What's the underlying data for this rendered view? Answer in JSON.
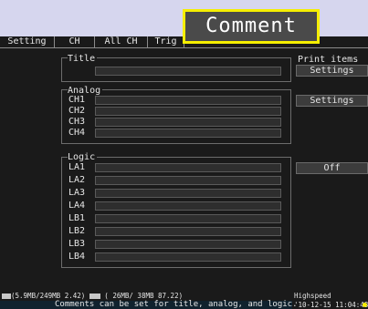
{
  "callout": {
    "label": "Comment"
  },
  "tabs": [
    "Setting",
    "CH",
    "All CH",
    "Trig"
  ],
  "title_section": {
    "label": "Title",
    "value": ""
  },
  "analog_section": {
    "label": "Analog",
    "channels": [
      {
        "name": "CH1",
        "value": ""
      },
      {
        "name": "CH2",
        "value": ""
      },
      {
        "name": "CH3",
        "value": ""
      },
      {
        "name": "CH4",
        "value": ""
      }
    ]
  },
  "logic_section": {
    "label": "Logic",
    "channels": [
      {
        "name": "LA1",
        "value": ""
      },
      {
        "name": "LA2",
        "value": ""
      },
      {
        "name": "LA3",
        "value": ""
      },
      {
        "name": "LA4",
        "value": ""
      },
      {
        "name": "LB1",
        "value": ""
      },
      {
        "name": "LB2",
        "value": ""
      },
      {
        "name": "LB3",
        "value": ""
      },
      {
        "name": "LB4",
        "value": ""
      }
    ]
  },
  "print_items": {
    "label": "Print items",
    "button": "Settings"
  },
  "analog_settings": {
    "button": "Settings"
  },
  "logic_toggle": {
    "button": "Off"
  },
  "status": {
    "memory": "(5.9MB/249MB 2.42) ",
    "storage": " ( 26MB/ 38MB 87.22)",
    "mode": "Highspeed",
    "datetime": "'10-12-15 11:04:48",
    "help": "Comments can be set for title, analog, and logic."
  },
  "colors": {
    "callout_border": "#f5ee00",
    "screen_bg": "#1a1a1a",
    "outer_bg": "#d6d6ee"
  }
}
